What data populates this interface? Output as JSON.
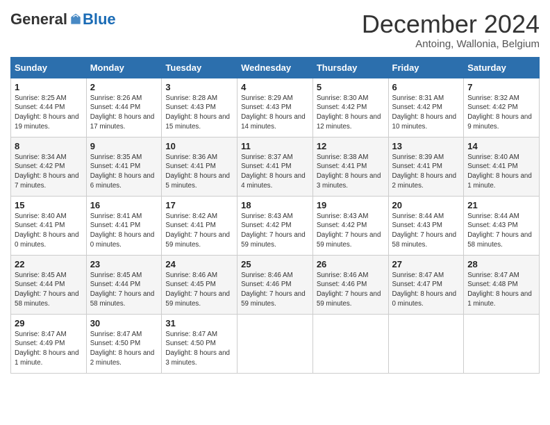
{
  "logo": {
    "general": "General",
    "blue": "Blue"
  },
  "title": "December 2024",
  "location": "Antoing, Wallonia, Belgium",
  "days_of_week": [
    "Sunday",
    "Monday",
    "Tuesday",
    "Wednesday",
    "Thursday",
    "Friday",
    "Saturday"
  ],
  "weeks": [
    [
      {
        "day": "1",
        "sunrise": "8:25 AM",
        "sunset": "4:44 PM",
        "daylight": "8 hours and 19 minutes."
      },
      {
        "day": "2",
        "sunrise": "8:26 AM",
        "sunset": "4:44 PM",
        "daylight": "8 hours and 17 minutes."
      },
      {
        "day": "3",
        "sunrise": "8:28 AM",
        "sunset": "4:43 PM",
        "daylight": "8 hours and 15 minutes."
      },
      {
        "day": "4",
        "sunrise": "8:29 AM",
        "sunset": "4:43 PM",
        "daylight": "8 hours and 14 minutes."
      },
      {
        "day": "5",
        "sunrise": "8:30 AM",
        "sunset": "4:42 PM",
        "daylight": "8 hours and 12 minutes."
      },
      {
        "day": "6",
        "sunrise": "8:31 AM",
        "sunset": "4:42 PM",
        "daylight": "8 hours and 10 minutes."
      },
      {
        "day": "7",
        "sunrise": "8:32 AM",
        "sunset": "4:42 PM",
        "daylight": "8 hours and 9 minutes."
      }
    ],
    [
      {
        "day": "8",
        "sunrise": "8:34 AM",
        "sunset": "4:42 PM",
        "daylight": "8 hours and 7 minutes."
      },
      {
        "day": "9",
        "sunrise": "8:35 AM",
        "sunset": "4:41 PM",
        "daylight": "8 hours and 6 minutes."
      },
      {
        "day": "10",
        "sunrise": "8:36 AM",
        "sunset": "4:41 PM",
        "daylight": "8 hours and 5 minutes."
      },
      {
        "day": "11",
        "sunrise": "8:37 AM",
        "sunset": "4:41 PM",
        "daylight": "8 hours and 4 minutes."
      },
      {
        "day": "12",
        "sunrise": "8:38 AM",
        "sunset": "4:41 PM",
        "daylight": "8 hours and 3 minutes."
      },
      {
        "day": "13",
        "sunrise": "8:39 AM",
        "sunset": "4:41 PM",
        "daylight": "8 hours and 2 minutes."
      },
      {
        "day": "14",
        "sunrise": "8:40 AM",
        "sunset": "4:41 PM",
        "daylight": "8 hours and 1 minute."
      }
    ],
    [
      {
        "day": "15",
        "sunrise": "8:40 AM",
        "sunset": "4:41 PM",
        "daylight": "8 hours and 0 minutes."
      },
      {
        "day": "16",
        "sunrise": "8:41 AM",
        "sunset": "4:41 PM",
        "daylight": "8 hours and 0 minutes."
      },
      {
        "day": "17",
        "sunrise": "8:42 AM",
        "sunset": "4:41 PM",
        "daylight": "7 hours and 59 minutes."
      },
      {
        "day": "18",
        "sunrise": "8:43 AM",
        "sunset": "4:42 PM",
        "daylight": "7 hours and 59 minutes."
      },
      {
        "day": "19",
        "sunrise": "8:43 AM",
        "sunset": "4:42 PM",
        "daylight": "7 hours and 59 minutes."
      },
      {
        "day": "20",
        "sunrise": "8:44 AM",
        "sunset": "4:43 PM",
        "daylight": "7 hours and 58 minutes."
      },
      {
        "day": "21",
        "sunrise": "8:44 AM",
        "sunset": "4:43 PM",
        "daylight": "7 hours and 58 minutes."
      }
    ],
    [
      {
        "day": "22",
        "sunrise": "8:45 AM",
        "sunset": "4:44 PM",
        "daylight": "7 hours and 58 minutes."
      },
      {
        "day": "23",
        "sunrise": "8:45 AM",
        "sunset": "4:44 PM",
        "daylight": "7 hours and 58 minutes."
      },
      {
        "day": "24",
        "sunrise": "8:46 AM",
        "sunset": "4:45 PM",
        "daylight": "7 hours and 59 minutes."
      },
      {
        "day": "25",
        "sunrise": "8:46 AM",
        "sunset": "4:46 PM",
        "daylight": "7 hours and 59 minutes."
      },
      {
        "day": "26",
        "sunrise": "8:46 AM",
        "sunset": "4:46 PM",
        "daylight": "7 hours and 59 minutes."
      },
      {
        "day": "27",
        "sunrise": "8:47 AM",
        "sunset": "4:47 PM",
        "daylight": "8 hours and 0 minutes."
      },
      {
        "day": "28",
        "sunrise": "8:47 AM",
        "sunset": "4:48 PM",
        "daylight": "8 hours and 1 minute."
      }
    ],
    [
      {
        "day": "29",
        "sunrise": "8:47 AM",
        "sunset": "4:49 PM",
        "daylight": "8 hours and 1 minute."
      },
      {
        "day": "30",
        "sunrise": "8:47 AM",
        "sunset": "4:50 PM",
        "daylight": "8 hours and 2 minutes."
      },
      {
        "day": "31",
        "sunrise": "8:47 AM",
        "sunset": "4:50 PM",
        "daylight": "8 hours and 3 minutes."
      },
      null,
      null,
      null,
      null
    ]
  ]
}
